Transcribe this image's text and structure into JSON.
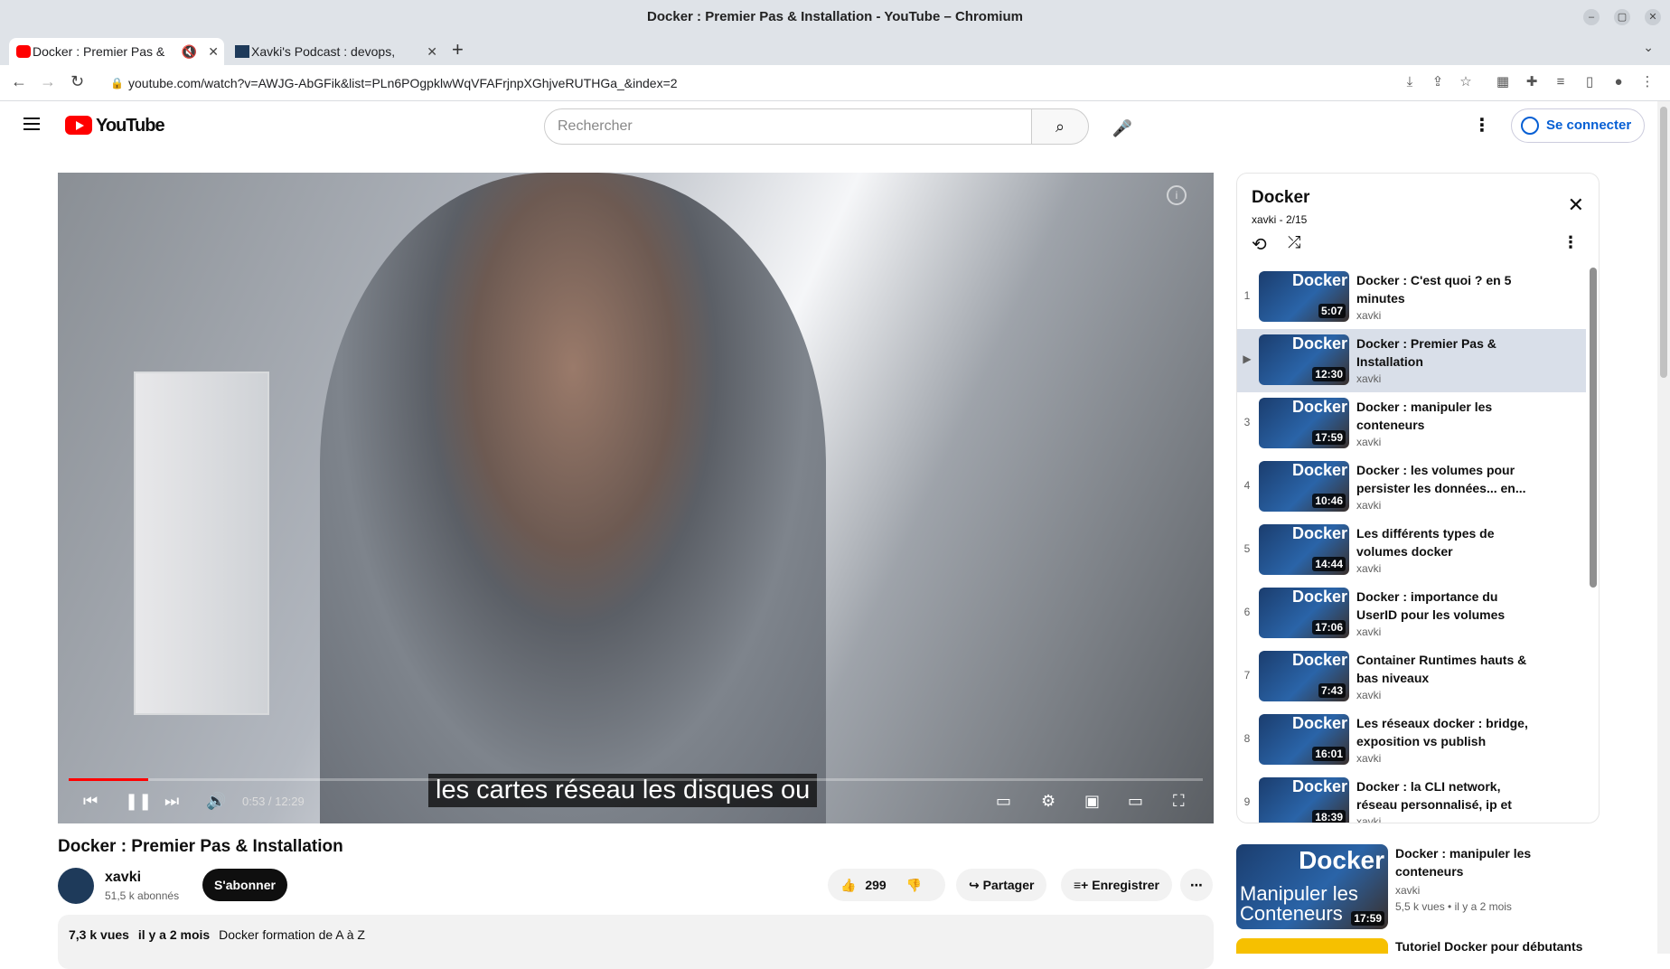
{
  "window": {
    "title": "Docker : Premier Pas & Installation - YouTube – Chromium"
  },
  "tabs": [
    {
      "label": "Docker : Premier Pas &",
      "active": true
    },
    {
      "label": "Xavki's Podcast : devops,",
      "active": false
    }
  ],
  "address": {
    "url": "youtube.com/watch?v=AWJG-AbGFik&list=PLn6POgpklwWqVFAFrjnpXGhjveRUTHGa_&index=2"
  },
  "youtube": {
    "logo_text": "YouTube",
    "search_placeholder": "Rechercher",
    "signin_label": "Se connecter"
  },
  "player": {
    "subtitle": "les cartes réseau les disques ou",
    "time": "0:53 / 12:29",
    "progress_fraction": 0.07
  },
  "video": {
    "title": "Docker : Premier Pas & Installation",
    "channel": "xavki",
    "subscribers": "51,5 k abonnés",
    "subscribe_label": "S'abonner",
    "likes": "299",
    "share_label": "Partager",
    "save_label": "Enregistrer",
    "views": "7,3 k vues",
    "age": "il y a 2 mois",
    "desc_line": "Docker formation de A à Z"
  },
  "playlist": {
    "title": "Docker",
    "subtitle": "xavki - 2/15",
    "items": [
      {
        "idx": "1",
        "title": "Docker : C'est quoi ? en 5 minutes",
        "channel": "xavki",
        "duration": "5:07"
      },
      {
        "idx": "▶",
        "title": "Docker : Premier Pas & Installation",
        "channel": "xavki",
        "duration": "12:30",
        "current": true
      },
      {
        "idx": "3",
        "title": "Docker : manipuler les conteneurs",
        "channel": "xavki",
        "duration": "17:59"
      },
      {
        "idx": "4",
        "title": "Docker : les volumes pour persister les données... en...",
        "channel": "xavki",
        "duration": "10:46"
      },
      {
        "idx": "5",
        "title": "Les différents types de volumes docker",
        "channel": "xavki",
        "duration": "14:44"
      },
      {
        "idx": "6",
        "title": "Docker : importance du UserID pour les volumes",
        "channel": "xavki",
        "duration": "17:06"
      },
      {
        "idx": "7",
        "title": "Container Runtimes hauts & bas niveaux",
        "channel": "xavki",
        "duration": "7:43"
      },
      {
        "idx": "8",
        "title": "Les réseaux docker : bridge, exposition vs publish",
        "channel": "xavki",
        "duration": "16:01"
      },
      {
        "idx": "9",
        "title": "Docker : la CLI network, réseau personnalisé, ip et driver host",
        "channel": "xavki",
        "duration": "18:39"
      }
    ]
  },
  "recommended": [
    {
      "title": "Docker : manipuler les conteneurs",
      "channel": "xavki",
      "meta": "5,5 k vues • il y a 2 mois",
      "duration": "17:59",
      "thumb_brand": "Docker",
      "thumb_tag": "Manipuler les Conteneurs"
    },
    {
      "title": "Tutoriel Docker pour débutants"
    }
  ]
}
